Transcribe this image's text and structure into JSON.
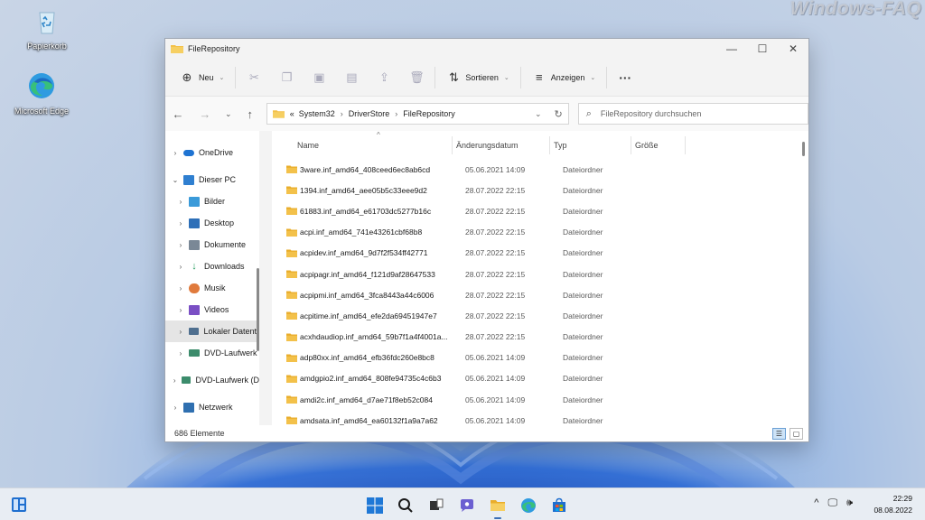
{
  "desktop": {
    "watermark": "Windows-FAQ",
    "icons": [
      {
        "label": "Papierkorb",
        "icon": "recycle-bin-icon"
      },
      {
        "label": "Microsoft Edge",
        "icon": "edge-icon"
      }
    ]
  },
  "window": {
    "title": "FileRepository",
    "controls": {
      "minimize": "—",
      "maximize": "☐",
      "close": "✕"
    },
    "commandbar": {
      "new_label": "Neu",
      "sort_label": "Sortieren",
      "view_label": "Anzeigen",
      "more": "···",
      "icons": [
        "cut-icon",
        "copy-icon",
        "paste-icon",
        "rename-icon",
        "share-icon",
        "delete-icon"
      ]
    },
    "address": {
      "prefix": "«",
      "crumbs": [
        "System32",
        "DriverStore",
        "FileRepository"
      ],
      "search_placeholder": "FileRepository durchsuchen"
    },
    "navpane": [
      {
        "label": "OneDrive",
        "chevron": "›",
        "color": "#1e73d2"
      },
      {
        "label": "Dieser PC",
        "chevron": "⌄",
        "color": "#2f7fd0"
      },
      {
        "label": "Bilder",
        "chevron": "›",
        "color": "#3a9ad9"
      },
      {
        "label": "Desktop",
        "chevron": "›",
        "color": "#2d6fb8"
      },
      {
        "label": "Dokumente",
        "chevron": "›",
        "color": "#7a8896"
      },
      {
        "label": "Downloads",
        "chevron": "›",
        "color": "#1e9a5a"
      },
      {
        "label": "Musik",
        "chevron": "›",
        "color": "#e07a3c"
      },
      {
        "label": "Videos",
        "chevron": "›",
        "color": "#7a4fc4"
      },
      {
        "label": "Lokaler Datentr",
        "chevron": "›",
        "color": "#4f6f8f"
      },
      {
        "label": "DVD-Laufwerk",
        "chevron": "›",
        "color": "#3c8c6c"
      },
      {
        "label": "DVD-Laufwerk (D",
        "chevron": "›",
        "color": "#3c8c6c"
      },
      {
        "label": "Netzwerk",
        "chevron": "›",
        "color": "#2f6fb0"
      }
    ],
    "columns": {
      "name": "Name",
      "date": "Änderungsdatum",
      "type": "Typ",
      "size": "Größe"
    },
    "files": [
      {
        "name": "3ware.inf_amd64_408ceed6ec8ab6cd",
        "date": "05.06.2021 14:09",
        "type": "Dateiordner"
      },
      {
        "name": "1394.inf_amd64_aee05b5c33eee9d2",
        "date": "28.07.2022 22:15",
        "type": "Dateiordner"
      },
      {
        "name": "61883.inf_amd64_e61703dc5277b16c",
        "date": "28.07.2022 22:15",
        "type": "Dateiordner"
      },
      {
        "name": "acpi.inf_amd64_741e43261cbf68b8",
        "date": "28.07.2022 22:15",
        "type": "Dateiordner"
      },
      {
        "name": "acpidev.inf_amd64_9d7f2f534ff42771",
        "date": "28.07.2022 22:15",
        "type": "Dateiordner"
      },
      {
        "name": "acpipagr.inf_amd64_f121d9af28647533",
        "date": "28.07.2022 22:15",
        "type": "Dateiordner"
      },
      {
        "name": "acpipmi.inf_amd64_3fca8443a44c6006",
        "date": "28.07.2022 22:15",
        "type": "Dateiordner"
      },
      {
        "name": "acpitime.inf_amd64_efe2da69451947e7",
        "date": "28.07.2022 22:15",
        "type": "Dateiordner"
      },
      {
        "name": "acxhdaudiop.inf_amd64_59b7f1a4f4001a...",
        "date": "28.07.2022 22:15",
        "type": "Dateiordner"
      },
      {
        "name": "adp80xx.inf_amd64_efb36fdc260e8bc8",
        "date": "05.06.2021 14:09",
        "type": "Dateiordner"
      },
      {
        "name": "amdgpio2.inf_amd64_808fe94735c4c6b3",
        "date": "05.06.2021 14:09",
        "type": "Dateiordner"
      },
      {
        "name": "amdi2c.inf_amd64_d7ae71f8eb52c084",
        "date": "05.06.2021 14:09",
        "type": "Dateiordner"
      },
      {
        "name": "amdsata.inf_amd64_ea60132f1a9a7a62",
        "date": "05.06.2021 14:09",
        "type": "Dateiordner"
      }
    ],
    "status": {
      "count": "686 Elemente"
    }
  },
  "taskbar": {
    "apps": [
      "start-icon",
      "search-icon",
      "task-view-icon",
      "chat-icon",
      "explorer-icon",
      "edge-icon",
      "store-icon"
    ],
    "tray": {
      "chevron": "^"
    },
    "time": "22:29",
    "date": "08.08.2022"
  },
  "colors": {
    "folder": "#f3c14a",
    "accent": "#3b6fb6"
  }
}
